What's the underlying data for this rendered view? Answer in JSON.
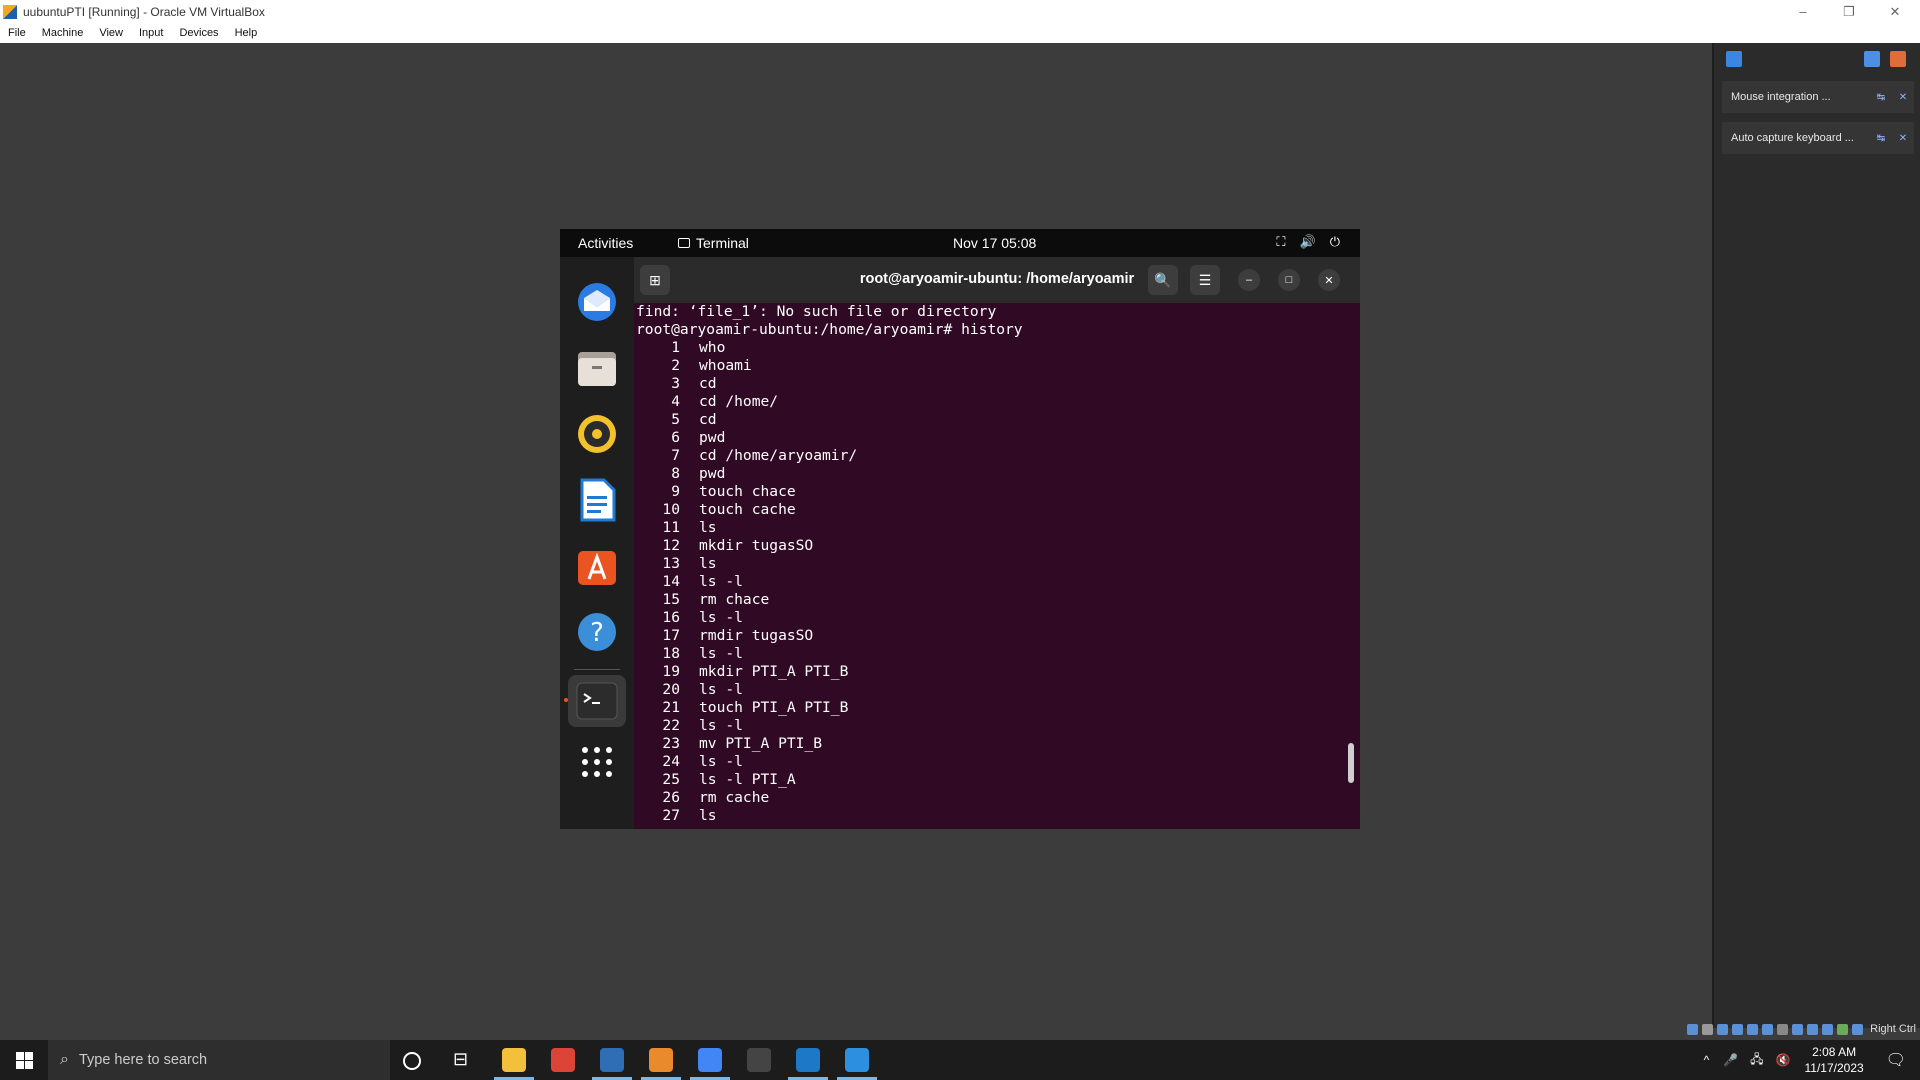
{
  "window": {
    "title": "uubuntuPTI [Running] - Oracle VM VirtualBox",
    "minimize": "–",
    "restore": "❐",
    "close": "✕"
  },
  "menubar": [
    "File",
    "Machine",
    "View",
    "Input",
    "Devices",
    "Help"
  ],
  "notifications": [
    {
      "label": "Mouse integration ...",
      "toggle": "↹",
      "dismiss": "✕"
    },
    {
      "label": "Auto capture keyboard ...",
      "toggle": "↹",
      "dismiss": "✕"
    }
  ],
  "vm_status": {
    "host_key": "Right Ctrl"
  },
  "guest": {
    "topbar": {
      "activities": "Activities",
      "app_name": "Terminal",
      "datetime": "Nov 17  05:08",
      "network": "⛶",
      "volume": "🔊",
      "power": "⏻"
    },
    "dock": [
      {
        "name": "thunderbird-icon",
        "color": "#2a7be4"
      },
      {
        "name": "files-icon",
        "color": "#d6d0c8"
      },
      {
        "name": "rhythmbox-icon",
        "color": "#f3c22b"
      },
      {
        "name": "writer-icon",
        "color": "#1f7ad1"
      },
      {
        "name": "software-icon",
        "color": "#e95420"
      },
      {
        "name": "help-icon",
        "color": "#3b8ed8"
      },
      {
        "name": "terminal-icon",
        "color": "#2c2c2c"
      },
      {
        "name": "app-grid-icon",
        "color": "#ffffff"
      }
    ],
    "terminal": {
      "title": "root@aryoamir-ubuntu: /home/aryoamir",
      "new_tab": "⊞",
      "search": "🔍",
      "menu": "☰",
      "minimize": "–",
      "maximize": "□",
      "close": "✕",
      "lines": [
        "find: ‘file_1’: No such file or directory",
        "root@aryoamir-ubuntu:/home/aryoamir# history"
      ],
      "history": [
        {
          "n": "1",
          "cmd": "who"
        },
        {
          "n": "2",
          "cmd": "whoami"
        },
        {
          "n": "3",
          "cmd": "cd"
        },
        {
          "n": "4",
          "cmd": "cd /home/"
        },
        {
          "n": "5",
          "cmd": "cd"
        },
        {
          "n": "6",
          "cmd": "pwd"
        },
        {
          "n": "7",
          "cmd": "cd /home/aryoamir/"
        },
        {
          "n": "8",
          "cmd": "pwd"
        },
        {
          "n": "9",
          "cmd": "touch chace"
        },
        {
          "n": "10",
          "cmd": "touch cache"
        },
        {
          "n": "11",
          "cmd": "ls"
        },
        {
          "n": "12",
          "cmd": "mkdir tugasSO"
        },
        {
          "n": "13",
          "cmd": "ls"
        },
        {
          "n": "14",
          "cmd": "ls -l"
        },
        {
          "n": "15",
          "cmd": "rm chace"
        },
        {
          "n": "16",
          "cmd": "ls -l"
        },
        {
          "n": "17",
          "cmd": "rmdir tugasSO"
        },
        {
          "n": "18",
          "cmd": "ls -l"
        },
        {
          "n": "19",
          "cmd": "mkdir PTI_A PTI_B"
        },
        {
          "n": "20",
          "cmd": "ls -l"
        },
        {
          "n": "21",
          "cmd": "touch PTI_A PTI_B"
        },
        {
          "n": "22",
          "cmd": "ls -l"
        },
        {
          "n": "23",
          "cmd": "mv PTI_A PTI_B"
        },
        {
          "n": "24",
          "cmd": "ls -l"
        },
        {
          "n": "25",
          "cmd": "ls -l PTI_A"
        },
        {
          "n": "26",
          "cmd": "rm cache"
        },
        {
          "n": "27",
          "cmd": "ls"
        }
      ]
    }
  },
  "taskbar": {
    "search_placeholder": "Type here to search",
    "time": "2:08 AM",
    "date": "11/17/2023",
    "apps": [
      {
        "name": "file-explorer-icon",
        "color": "#f3c03b"
      },
      {
        "name": "chrome-icon",
        "color": "#db4437"
      },
      {
        "name": "virtualbox-icon",
        "color": "#2f6db5"
      },
      {
        "name": "paint-icon",
        "color": "#e98a2c"
      },
      {
        "name": "chrome-profile-icon",
        "color": "#4285f4"
      },
      {
        "name": "obs-icon",
        "color": "#444444"
      },
      {
        "name": "virtualbox-vm-icon",
        "color": "#1e78c8"
      },
      {
        "name": "photos-icon",
        "color": "#2d8fe0"
      }
    ]
  }
}
